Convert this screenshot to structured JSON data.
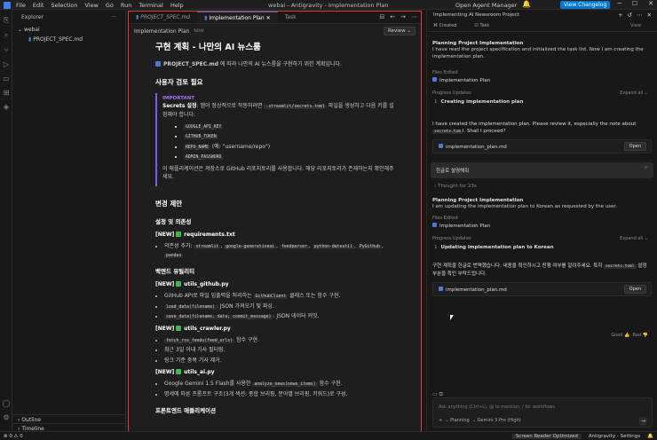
{
  "titlebar": {
    "menu": [
      "File",
      "Edit",
      "Selection",
      "View",
      "Go",
      "Run",
      "Terminal",
      "Help"
    ],
    "title": "webai - Antigravity - Implementation Plan",
    "agent_manager": "Open Agent Manager",
    "changelog": "View Changelog"
  },
  "sidebar": {
    "header": "Explorer",
    "folder": "webai",
    "file": "PROJECT_SPEC.md",
    "outline": "Outline",
    "timeline": "Timeline"
  },
  "editor": {
    "tabs": [
      "PROJECT_SPEC.md",
      "Implementation Plan",
      "Task"
    ],
    "header_title": "Implementation Plan",
    "header_now": "NOW",
    "review_button": "Review",
    "doc": {
      "h1": "구현 계획 - 나만의 AI 뉴스룸",
      "intro_file": "PROJECT_SPEC.md",
      "intro_rest": " 에 따라 나만의 AI 뉴스룸을 구현하기 위한 계획입니다.",
      "review_heading": "사용자 검토 필요",
      "important_label": "IMPORTANT",
      "secrets_bold": "Secrets 설정",
      "secrets_text1": ": 앱이 정상적으로 작동하려면 ",
      "secrets_code": ".streamlit/secrets.toml",
      "secrets_text2": " 파일을 생성하고 다음 키를 설정해야 합니다:",
      "secret_keys": [
        "GOOGLE_API_KEY",
        "GITHUB_TOKEN",
        "REPO_NAME",
        "ADMIN_PASSWORD"
      ],
      "repo_name_note": " (예: \"username/repo\")",
      "repo_note": "이 애플리케이션은 저장소로 GitHub 리포지토리를 사용합니다. 해당 리포지토리가 존재하는지 확인해주세요.",
      "changes_heading": "변경 제안",
      "settings_heading": "설정 및 의존성",
      "new_tag": "[NEW]",
      "requirements_file": "requirements.txt",
      "deps_label": "의존성 추가: ",
      "deps": [
        "streamlit",
        "google-generativeai",
        "feedparser",
        "python-dateutil",
        "PyGithub",
        "pandas"
      ],
      "backend_heading": "백엔드 유틸리티",
      "github_file": "utils_github.py",
      "github_items": [
        {
          "pre": "GitHub API로 파일 입출력을 처리하는 ",
          "code": "GithubClient",
          "post": " 클래스 또는 함수 구현."
        },
        {
          "pre": "",
          "code": "load_data(filename)",
          "post": ": JSON 가져오기 및 파싱."
        },
        {
          "pre": "",
          "code": "save_data(filename, data, commit_message)",
          "post": ": JSON 데이터 커밋."
        }
      ],
      "crawler_file": "utils_crawler.py",
      "crawler_items": [
        {
          "pre": "",
          "code": "fetch_rss_feeds(feed_urls)",
          "post": " 함수 구현."
        },
        {
          "pre": "최근 3일 이내 기사 필터링.",
          "code": "",
          "post": ""
        },
        {
          "pre": "링크 기준 중복 기사 제거.",
          "code": "",
          "post": ""
        }
      ],
      "ai_file": "utils_ai.py",
      "ai_items": [
        {
          "pre": "Google Gemini 1.5 Flash를 사용한 ",
          "code": "analyze_news(news_items)",
          "post": " 함수 구현."
        },
        {
          "pre": "명세에 따른 프롬프트 구조(3개 섹션: 종합 브리핑, 분야별 브리핑, 키워드)로 구성.",
          "code": "",
          "post": ""
        }
      ],
      "frontend_heading": "프론트엔드 애플리케이션"
    }
  },
  "rpanel": {
    "title": "Implementing AI Newsroom Project",
    "subtabs": [
      "Created",
      "Task"
    ],
    "view": "View",
    "card1_title": "Planning Project Implementation",
    "card1_desc": "I have read the project specification and initialized the task list. Now I am creating the implementation plan.",
    "files_edited": "Files Edited",
    "file1": "Implementation Plan",
    "progress_updates": "Progress Updates",
    "expand_all": "Expand all",
    "step1_num": "1",
    "step1_text": "Creating implementation plan",
    "msg1_a": "I have created the implementation plan. Please review it, especially the note about ",
    "msg1_code": "secrets.tom",
    "msg1_b": "l. Shall I proceed?",
    "filecard1": "implementation_plan.md",
    "open1": "Open",
    "user_msg": "한글로 설명해줘",
    "thought": "Thought for 23s",
    "card2_title": "Planning Project Implementation",
    "card2_desc": "I am updating the implementation plan to Korean as requested by the user.",
    "file2": "Implementation Plan",
    "step2_num": "1",
    "step2_text": "Updating implementation plan to Korean",
    "msg2_a": "구현 계획을 한글로 번역했습니다. 내용을 확인하시고 진행 여부를 알려주세요. 특히 ",
    "msg2_code": "secrets.toml",
    "msg2_b": " 설정 부분을 확인 부탁드립니다.",
    "filecard2": "implementation_plan.md",
    "open2": "Open",
    "good": "Good",
    "bad": "Bad",
    "input_placeholder": "Ask anything (Ctrl+L), @ to mention, / for workflows",
    "planning": "Planning",
    "model": "Gemini 3 Pro (High)"
  },
  "statusbar": {
    "errors": "0",
    "warnings": "0",
    "screen_reader": "Screen Reader Optimized",
    "settings": "Antigravity - Settings"
  },
  "colors": {
    "accent": "#0078d4",
    "highlight_border": "#e53935",
    "important": "#a371f7"
  }
}
